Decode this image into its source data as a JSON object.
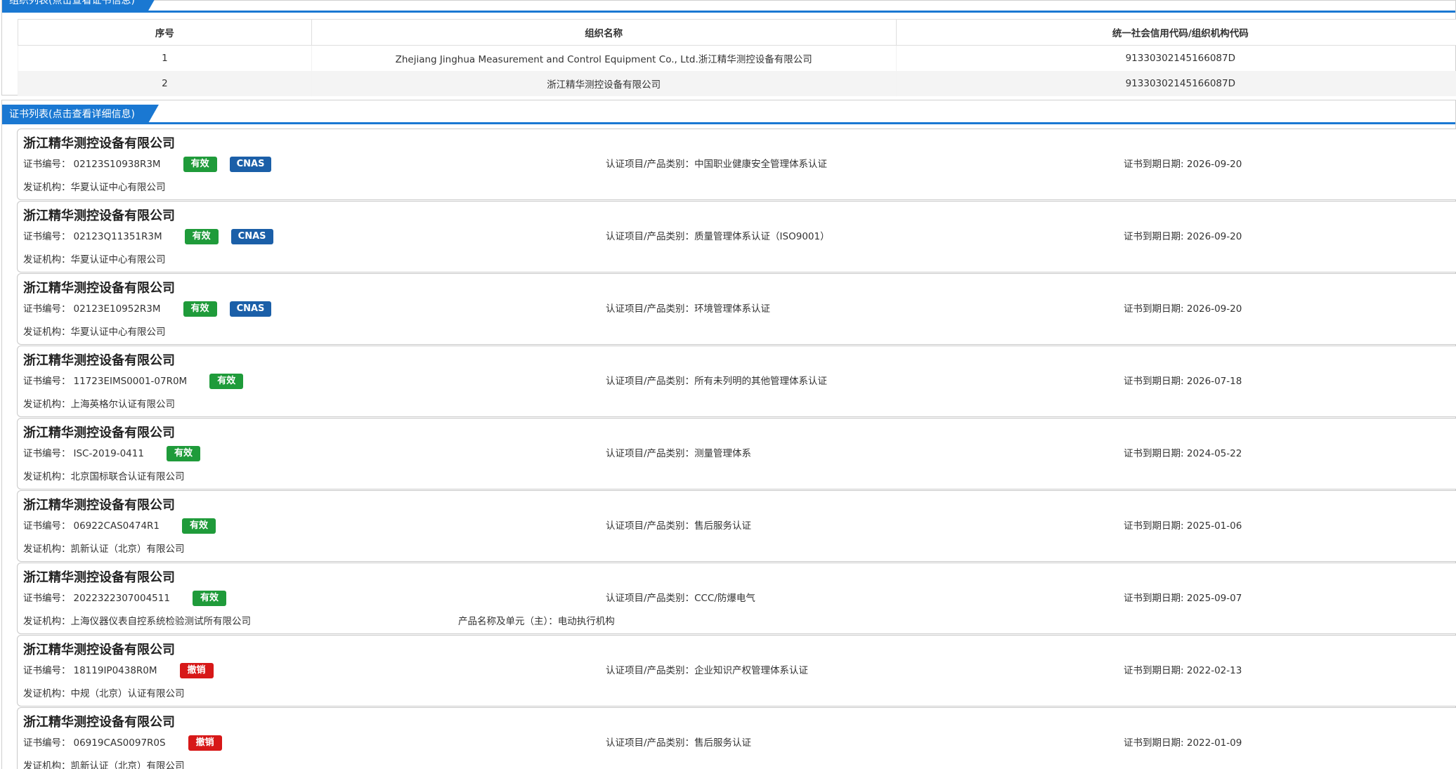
{
  "org_section": {
    "tab_label": "组织列表(点击查看证书信息)",
    "headers": [
      "序号",
      "组织名称",
      "统一社会信用代码/组织机构代码"
    ],
    "rows": [
      {
        "index": "1",
        "name": "Zhejiang Jinghua Measurement and Control Equipment Co., Ltd.浙江精华测控设备有限公司",
        "code": "91330302145166087D"
      },
      {
        "index": "2",
        "name": "浙江精华测控设备有限公司",
        "code": "91330302145166087D"
      }
    ]
  },
  "cert_section": {
    "tab_label": "证书列表(点击查看详细信息)",
    "labels": {
      "cert_no": "证书编号：",
      "item": "认证项目/产品类别：",
      "expiry": "证书到期日期:",
      "issuer": "发证机构：",
      "product": "产品名称及单元（主）："
    },
    "colors": {
      "valid": "#1f9b3a",
      "revoked": "#d71818",
      "cnas": "#1b5fa8",
      "accent": "#1a78d2"
    },
    "certs": [
      {
        "company": "浙江精华测控设备有限公司",
        "cert_no": "02123S10938R3M",
        "status": "有效",
        "cnas": "CNAS",
        "item": "中国职业健康安全管理体系认证",
        "expiry": "2026-09-20",
        "issuer": "华夏认证中心有限公司",
        "product": ""
      },
      {
        "company": "浙江精华测控设备有限公司",
        "cert_no": "02123Q11351R3M",
        "status": "有效",
        "cnas": "CNAS",
        "item": "质量管理体系认证（ISO9001）",
        "expiry": "2026-09-20",
        "issuer": "华夏认证中心有限公司",
        "product": ""
      },
      {
        "company": "浙江精华测控设备有限公司",
        "cert_no": "02123E10952R3M",
        "status": "有效",
        "cnas": "CNAS",
        "item": "环境管理体系认证",
        "expiry": "2026-09-20",
        "issuer": "华夏认证中心有限公司",
        "product": ""
      },
      {
        "company": "浙江精华测控设备有限公司",
        "cert_no": "11723EIMS0001-07R0M",
        "status": "有效",
        "cnas": "",
        "item": "所有未列明的其他管理体系认证",
        "expiry": "2026-07-18",
        "issuer": "上海英格尔认证有限公司",
        "product": ""
      },
      {
        "company": "浙江精华测控设备有限公司",
        "cert_no": "ISC-2019-0411",
        "status": "有效",
        "cnas": "",
        "item": "测量管理体系",
        "expiry": "2024-05-22",
        "issuer": "北京国标联合认证有限公司",
        "product": ""
      },
      {
        "company": "浙江精华测控设备有限公司",
        "cert_no": "06922CAS0474R1",
        "status": "有效",
        "cnas": "",
        "item": "售后服务认证",
        "expiry": "2025-01-06",
        "issuer": "凯新认证（北京）有限公司",
        "product": ""
      },
      {
        "company": "浙江精华测控设备有限公司",
        "cert_no": "2022322307004511",
        "status": "有效",
        "cnas": "",
        "item": "CCC/防爆电气",
        "expiry": "2025-09-07",
        "issuer": "上海仪器仪表自控系统检验测试所有限公司",
        "product": "电动执行机构"
      },
      {
        "company": "浙江精华测控设备有限公司",
        "cert_no": "18119IP0438R0M",
        "status": "撤销",
        "cnas": "",
        "item": "企业知识产权管理体系认证",
        "expiry": "2022-02-13",
        "issuer": "中规（北京）认证有限公司",
        "product": ""
      },
      {
        "company": "浙江精华测控设备有限公司",
        "cert_no": "06919CAS0097R0S",
        "status": "撤销",
        "cnas": "",
        "item": "售后服务认证",
        "expiry": "2022-01-09",
        "issuer": "凯新认证（北京）有限公司",
        "product": ""
      }
    ]
  }
}
